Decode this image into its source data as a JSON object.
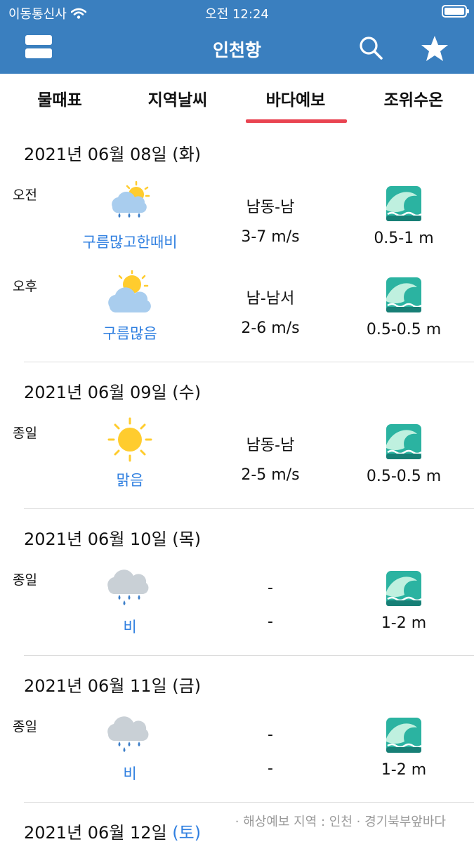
{
  "status_bar": {
    "carrier": "이동통신사",
    "time": "오전 12:24"
  },
  "nav": {
    "title": "인천항"
  },
  "tabs": [
    {
      "label": "물때표"
    },
    {
      "label": "지역날씨"
    },
    {
      "label": "바다예보",
      "active": true
    },
    {
      "label": "조위수온"
    }
  ],
  "days": [
    {
      "date": "2021년 06월 08일",
      "dow": "(화)",
      "rows": [
        {
          "period": "오전",
          "weather": "구름많고한때비",
          "icon": "cloud-sun-rain-icon",
          "wind_dir": "남동-남",
          "wind_speed": "3-7 m/s",
          "wave": "0.5-1 m"
        },
        {
          "period": "오후",
          "weather": "구름많음",
          "icon": "cloud-sun-icon",
          "wind_dir": "남-남서",
          "wind_speed": "2-6 m/s",
          "wave": "0.5-0.5 m"
        }
      ]
    },
    {
      "date": "2021년 06월 09일",
      "dow": "(수)",
      "rows": [
        {
          "period": "종일",
          "weather": "맑음",
          "icon": "sun-icon",
          "wind_dir": "남동-남",
          "wind_speed": "2-5 m/s",
          "wave": "0.5-0.5 m"
        }
      ]
    },
    {
      "date": "2021년 06월 10일",
      "dow": "(목)",
      "rows": [
        {
          "period": "종일",
          "weather": "비",
          "icon": "rain-cloud-icon",
          "wind_dir": "-",
          "wind_speed": "-",
          "wave": "1-2 m"
        }
      ]
    },
    {
      "date": "2021년 06월 11일",
      "dow": "(금)",
      "rows": [
        {
          "period": "종일",
          "weather": "비",
          "icon": "rain-cloud-icon",
          "wind_dir": "-",
          "wind_speed": "-",
          "wave": "1-2 m"
        }
      ]
    },
    {
      "date": "2021년 06월 12일",
      "dow": "(토)",
      "rows": []
    }
  ],
  "footer": "· 해상예보 지역 : 인천 · 경기북부앞바다",
  "colors": {
    "header": "#3a7fbf",
    "accent_red": "#e94451",
    "link_blue": "#2f7fe0",
    "wave_teal": "#1fa79a"
  }
}
